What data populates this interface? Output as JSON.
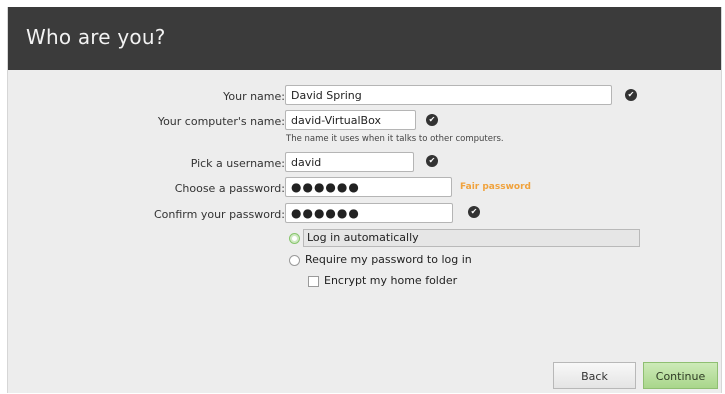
{
  "header": {
    "title": "Who are you?"
  },
  "form": {
    "name": {
      "label": "Your name:",
      "value": "David Spring"
    },
    "computer": {
      "label": "Your computer's name:",
      "value": "david-VirtualBox",
      "hint": "The name it uses when it talks to other computers."
    },
    "username": {
      "label": "Pick a username:",
      "value": "david"
    },
    "password": {
      "label": "Choose a password:",
      "value": "●●●●●●",
      "strength": "Fair password"
    },
    "confirm": {
      "label": "Confirm your password:",
      "value": "●●●●●●"
    },
    "check_glyph": "✔"
  },
  "login": {
    "auto": "Log in automatically",
    "require": "Require my password to log in",
    "encrypt": "Encrypt my home folder",
    "selected": "auto"
  },
  "buttons": {
    "back": "Back",
    "continue": "Continue"
  },
  "colors": {
    "header_bg": "#3b3b3b",
    "body_bg": "#ededed",
    "strength": "#f0a23c",
    "primary": "#a9d68b"
  }
}
